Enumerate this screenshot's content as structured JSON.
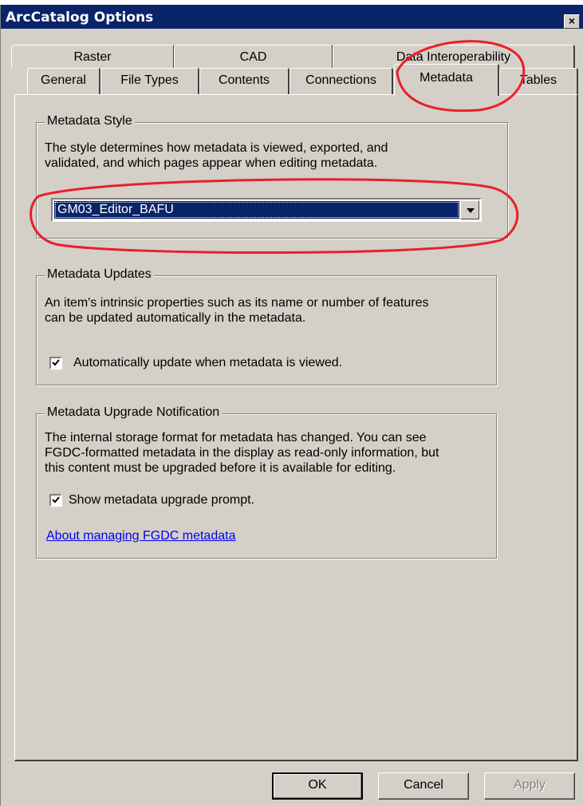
{
  "window": {
    "title": "ArcCatalog Options",
    "close_glyph": "×"
  },
  "tabs": {
    "row1": [
      "Raster",
      "CAD",
      "Data Interoperability"
    ],
    "row2": [
      "General",
      "File Types",
      "Contents",
      "Connections",
      "Metadata",
      "Tables"
    ],
    "active": "Metadata"
  },
  "metadata_style": {
    "legend": "Metadata Style",
    "description_lines": [
      "The style determines how metadata is viewed, exported, and",
      "validated, and which pages appear when editing metadata."
    ],
    "selected": "GM03_Editor_BAFU"
  },
  "metadata_updates": {
    "legend": "Metadata Updates",
    "description_lines": [
      "An item's intrinsic properties such as its name or number of features",
      "can be updated automatically in the metadata."
    ],
    "checkbox_label": "Automatically update when metadata is viewed.",
    "checked": true
  },
  "upgrade_notification": {
    "legend": "Metadata Upgrade Notification",
    "description_lines": [
      "The internal storage format for metadata has changed. You can see",
      "FGDC-formatted metadata in the display as read-only information, but",
      "this content must be upgraded before it is available for editing."
    ],
    "checkbox_label": "Show metadata upgrade prompt.",
    "checked": true,
    "link_text": "About managing FGDC metadata"
  },
  "buttons": {
    "ok": "OK",
    "cancel": "Cancel",
    "apply": "Apply"
  },
  "colors": {
    "titlebar": "#0a246a",
    "annotation": "#e8202a",
    "face": "#d4d0c8"
  },
  "icons": {
    "close": "close-icon",
    "dropdown": "chevron-down-icon",
    "check": "checkmark-icon"
  }
}
